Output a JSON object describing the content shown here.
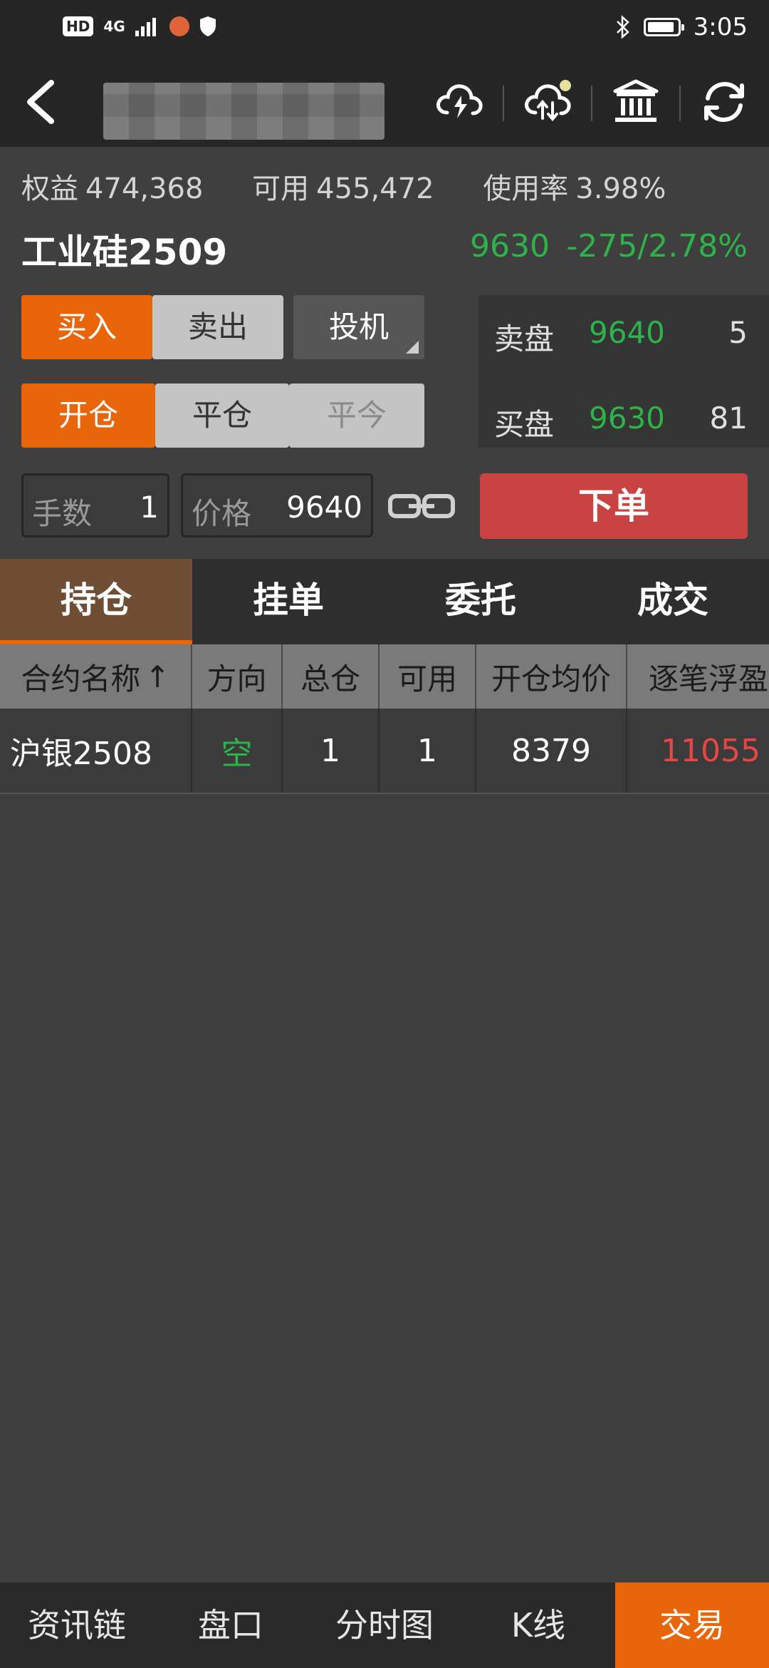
{
  "status_bar": {
    "hd_badge": "HD",
    "network": "4G",
    "time": "3:05",
    "icons": [
      "signal-icon",
      "app-notification-icon",
      "shield-icon",
      "bluetooth-icon",
      "battery-icon"
    ]
  },
  "top_bar": {
    "icons": [
      "back-icon",
      "cloud-lightning-icon",
      "cloud-sync-icon",
      "bank-icon",
      "refresh-icon"
    ],
    "cloud_badge_color": "#e8e0a0"
  },
  "account": {
    "equity_label": "权益",
    "equity_value": "474,368",
    "available_label": "可用",
    "available_value": "455,472",
    "usage_label": "使用率",
    "usage_value": "3.98%"
  },
  "quote": {
    "contract": "工业硅2509",
    "last_price": "9630",
    "change": "-275/2.78%"
  },
  "order_panel": {
    "side_buy": "买入",
    "side_sell": "卖出",
    "hedge_type": "投机",
    "open": "开仓",
    "close": "平仓",
    "close_today": "平今",
    "qty_label": "手数",
    "qty_value": "1",
    "price_label": "价格",
    "price_value": "9640",
    "submit": "下单"
  },
  "order_book": {
    "ask_label": "卖盘",
    "ask_price": "9640",
    "ask_volume": "5",
    "bid_label": "买盘",
    "bid_price": "9630",
    "bid_volume": "81"
  },
  "tabs": [
    "持仓",
    "挂单",
    "委托",
    "成交"
  ],
  "positions": {
    "headers": [
      "合约名称",
      "方向",
      "总仓",
      "可用",
      "开仓均价",
      "逐笔浮盈"
    ],
    "sort_indicator": "↑",
    "rows": [
      {
        "name": "沪银2508",
        "direction": "空",
        "total": "1",
        "available": "1",
        "avg_price": "8379",
        "pnl": "11055"
      }
    ]
  },
  "bottom_nav": [
    "资讯链",
    "盘口",
    "分时图",
    "K线",
    "交易"
  ],
  "colors": {
    "accent": "#e8650a",
    "up_red": "#e84545",
    "down_green": "#2db34a",
    "order_button": "#c94343"
  }
}
